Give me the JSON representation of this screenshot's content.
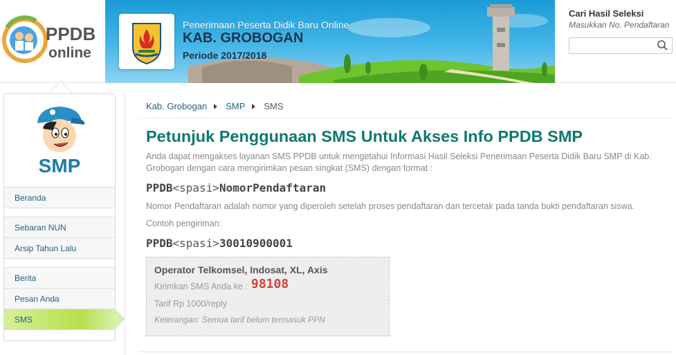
{
  "header": {
    "logo_text_top": "PPDB",
    "logo_text_bottom": "online",
    "banner": {
      "subtitle": "Penerimaan Peserta Didik Baru Online",
      "title": "KAB. GROBOGAN",
      "period": "Periode 2017/2018"
    },
    "search": {
      "title": "Cari Hasil Seleksi",
      "subtitle": "Masukkan No. Pendaftaran",
      "placeholder": "",
      "button_icon": "search-icon"
    }
  },
  "sidebar": {
    "title": "SMP",
    "groups": [
      [
        {
          "label": "Beranda",
          "active": false
        }
      ],
      [
        {
          "label": "Sebaran NUN",
          "active": false
        },
        {
          "label": "Arsip Tahun Lalu",
          "active": false
        }
      ],
      [
        {
          "label": "Berita",
          "active": false
        },
        {
          "label": "Pesan Anda",
          "active": false
        },
        {
          "label": "SMS",
          "active": true
        }
      ]
    ]
  },
  "breadcrumb": [
    "Kab. Grobogan",
    "SMP",
    "SMS"
  ],
  "main": {
    "title": "Petunjuk Penggunaan SMS Untuk Akses Info PPDB SMP",
    "intro": "Anda dapat mengakses layanan SMS PPDB untuk mengetahui Informasi Hasil Seleksi Penerimaan Peserta Didik Baru SMP di Kab. Grobogan dengan cara mengirimkan pesan singkat (SMS) dengan format :",
    "format": {
      "prefix": "PPDB",
      "space": "<spasi>",
      "suffix": "NomorPendaftaran"
    },
    "description": "Nomor Pendaftaran adalah nomor yang diperoleh setelah proses pendaftaran dan tercetak pada tanda bukti pendaftaran siswa.",
    "example_label": "Contoh pengiriman:",
    "example": {
      "prefix": "PPDB",
      "space": "<spasi>",
      "suffix": "30010900001"
    },
    "info_box": {
      "operator": "Operator Telkomsel, Indosat, XL, Axis",
      "send_label": "Kirimkan SMS Anda ke :",
      "number": "98108",
      "tarif": "Tarif Rp 1000/reply",
      "note": "Keterangan: Semua tarif belum termasuk PPN"
    }
  },
  "colors": {
    "title_green": "#0e7a6e",
    "link_blue": "#1f5e85",
    "sms_number_red": "#d0453a",
    "active_menu_green": "#b4e04c"
  }
}
